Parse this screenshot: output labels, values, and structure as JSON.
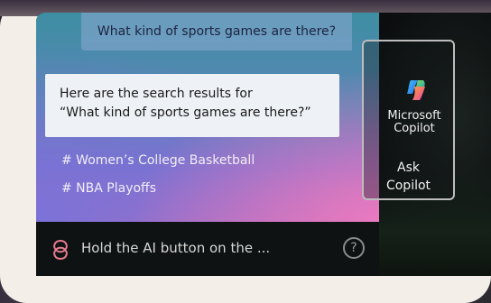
{
  "assistant": {
    "query": "What kind of sports games are there?",
    "result_line1": "Here are the search results for",
    "result_line2": "“What kind of sports games are there?”",
    "tags": [
      "# Women’s College Basketball",
      "# NBA Playoffs"
    ]
  },
  "bottom_bar": {
    "hint": "Hold the AI button on the ...",
    "help_symbol": "?"
  },
  "copilot": {
    "brand_line1": "Microsoft",
    "brand_line2": "Copilot",
    "ask_line1": "Ask",
    "ask_line2": "Copilot"
  },
  "colors": {
    "ai_icon": "#e67a8e",
    "panel_top": "#3d8ea3",
    "panel_bottom_right": "#e97ac0"
  },
  "icons": {
    "ai": "ai-assistant-icon",
    "help": "help-circle-icon",
    "copilot": "copilot-logo-icon"
  }
}
